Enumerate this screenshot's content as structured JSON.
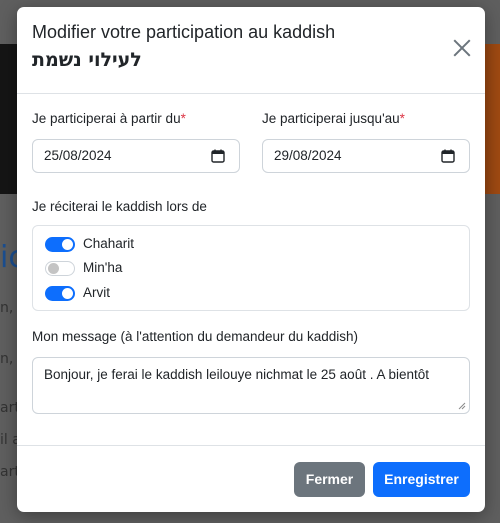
{
  "background": {
    "blue_fragment": "ic",
    "text_fragments": [
      "n, v",
      "n, v",
      "art",
      "il a",
      "art"
    ]
  },
  "modal": {
    "title": "Modifier votre participation au kaddish",
    "subtitle": "לעילוי נשמת",
    "close_icon": "close-icon"
  },
  "form": {
    "start_label": "Je participerai à partir du",
    "start_value": "25/08/2024",
    "end_label": "Je participerai jusqu'au",
    "end_value": "29/08/2024",
    "required_marker": "*",
    "prayers_label": "Je réciterai le kaddish lors de",
    "prayers": [
      {
        "label": "Chaharit",
        "checked": true
      },
      {
        "label": "Min'ha",
        "checked": false
      },
      {
        "label": "Arvit",
        "checked": true
      }
    ],
    "message_label": "Mon message (à l'attention du demandeur du kaddish)",
    "message_value": "Bonjour, je ferai le kaddish leilouye nichmat le 25 août . A bientôt"
  },
  "footer": {
    "close_label": "Fermer",
    "save_label": "Enregistrer"
  },
  "colors": {
    "primary": "#0d6efd",
    "secondary": "#6c757d",
    "required": "#dc3545"
  }
}
